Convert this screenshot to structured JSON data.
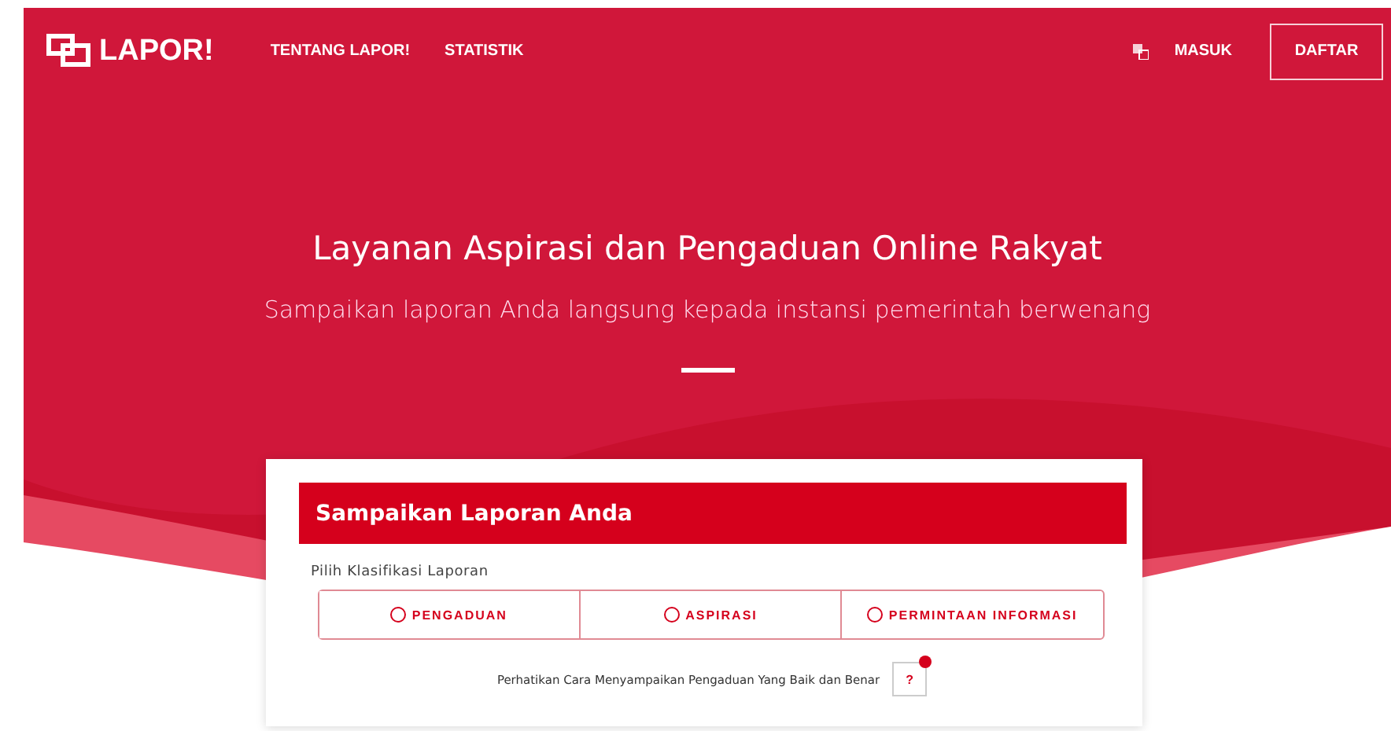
{
  "nav": {
    "brand": "LAPOR!",
    "links": [
      "TENTANG LAPOR!",
      "STATISTIK"
    ],
    "login": "MASUK",
    "register": "DAFTAR"
  },
  "hero": {
    "title": "Layanan Aspirasi dan Pengaduan Online Rakyat",
    "subtitle": "Sampaikan laporan Anda langsung kepada instansi pemerintah berwenang"
  },
  "form": {
    "title": "Sampaikan Laporan Anda",
    "classification_label": "Pilih Klasifikasi Laporan",
    "options": [
      {
        "label": "PENGADUAN",
        "selected": false
      },
      {
        "label": "ASPIRASI",
        "selected": false
      },
      {
        "label": "PERMINTAAN INFORMASI",
        "selected": false
      }
    ],
    "note": "Perhatikan Cara Menyampaikan Pengaduan Yang Baik dan Benar",
    "help_button": "?"
  }
}
